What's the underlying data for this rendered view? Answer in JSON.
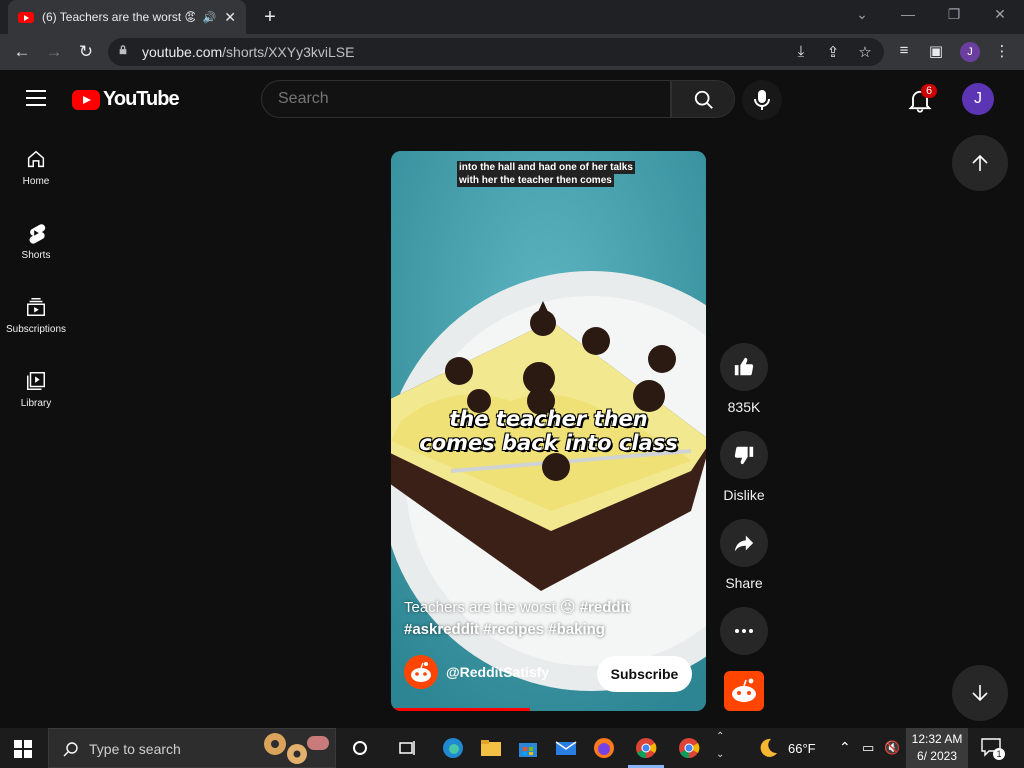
{
  "browser": {
    "tab_title": "(6) Teachers are the worst 😡",
    "url_domain": "youtube.com",
    "url_path": "/shorts/XXYy3kviLSE",
    "profile_initial": "J"
  },
  "masthead": {
    "logo_text": "YouTube",
    "search_placeholder": "Search",
    "notification_count": "6",
    "avatar_initial": "J"
  },
  "guide": {
    "items": [
      {
        "label": "Home",
        "icon": "home-icon"
      },
      {
        "label": "Shorts",
        "icon": "shorts-icon"
      },
      {
        "label": "Subscriptions",
        "icon": "subscriptions-icon"
      },
      {
        "label": "Library",
        "icon": "library-icon"
      }
    ]
  },
  "short": {
    "caption_top_line1": "into the hall and had one of her talks",
    "caption_top_line2": "with her the teacher then comes",
    "caption_mid_line1": "the teacher then",
    "caption_mid_line2": "comes back into class",
    "title": "Teachers are the worst 😡",
    "hashtags_line1": "#reddit",
    "hashtags_line2": "#askreddit #recipes #baking",
    "channel": "@RedditSatisfy",
    "subscribe_label": "Subscribe",
    "progress_fraction": 0.44
  },
  "actions": {
    "like_count": "835K",
    "dislike_label": "Dislike",
    "share_label": "Share"
  },
  "taskbar": {
    "search_placeholder": "Type to search",
    "weather": "66°F",
    "time": "12:32 AM",
    "date": "6/ 2023",
    "notification_count": "1"
  },
  "colors": {
    "youtube_red": "#ff0000",
    "background": "#0f0f0f",
    "reddit_orange": "#ff4500"
  }
}
